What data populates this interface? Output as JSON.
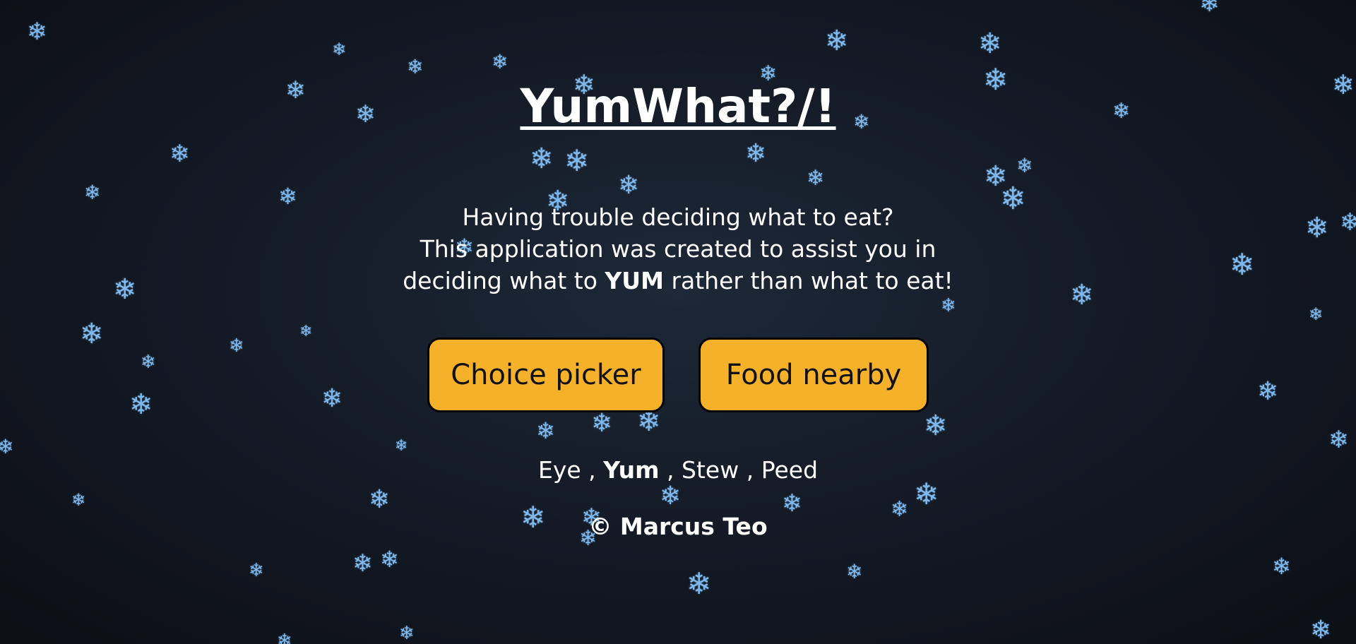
{
  "page": {
    "title": "YumWhat?/!",
    "intro": {
      "line1": "Having trouble deciding what to eat?",
      "line2": "This application was created to assist you in",
      "line3_before": "deciding what to",
      "line3_bold": "YUM",
      "line3_after": "rather than what to eat!"
    },
    "buttons": {
      "choice_picker": "Choice picker",
      "food_nearby": "Food nearby"
    },
    "tagline": {
      "word1": "Eye",
      "word2": "Yum",
      "word3": "Stew",
      "word4": "Peed",
      "separator": ","
    },
    "copyright": "© Marcus Teo"
  },
  "colors": {
    "background": "#141b26",
    "button_fill": "#f6b12b",
    "snowflake": "#7fb8ec",
    "text": "#ffffff"
  },
  "icons": {
    "snowflake": "snowflake-icon",
    "glyph": "❄"
  }
}
